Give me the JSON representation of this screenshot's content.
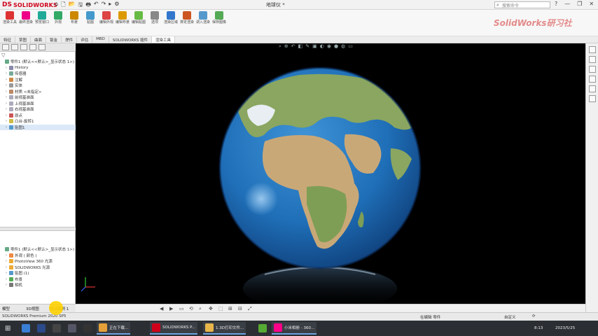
{
  "app": {
    "logo_prefix": "DS",
    "logo_name": "SOLIDWORKS",
    "doc_title": "地球仪 *",
    "search_placeholder": "搜索命令",
    "watermark": "SolidWorks研习社"
  },
  "quick_access": [
    "⌂",
    "🗋",
    "📂",
    "🖫",
    "🖶",
    "↶",
    "↷",
    "▸",
    "⚙"
  ],
  "window_buttons": [
    "?",
    "—",
    "❐",
    "✕"
  ],
  "ribbon_tools": [
    {
      "label": "渲染工具",
      "color": "#d33"
    },
    {
      "label": "最终渲染",
      "color": "#e08"
    },
    {
      "label": "预览窗口",
      "color": "#2a9"
    },
    {
      "label": "外观",
      "color": "#3a6"
    },
    {
      "label": "布景",
      "color": "#c80"
    },
    {
      "label": "贴图",
      "color": "#49c"
    },
    {
      "label": "编辑外观",
      "color": "#d44"
    },
    {
      "label": "编辑布景",
      "color": "#d90"
    },
    {
      "label": "编辑贴图",
      "color": "#6b4"
    },
    {
      "label": "选项",
      "color": "#888"
    },
    {
      "label": "渲染区域",
      "color": "#37c"
    },
    {
      "label": "排定渲染",
      "color": "#c52"
    },
    {
      "label": "调入渲染",
      "color": "#59c"
    },
    {
      "label": "保存图像",
      "color": "#5a5"
    }
  ],
  "tabs": [
    "特征",
    "草图",
    "曲面",
    "钣金",
    "焊件",
    "评估",
    "MBD",
    "SOLIDWORKS 插件",
    "渲染工具"
  ],
  "active_tab": 8,
  "feature_tree": [
    {
      "label": "零件1 (默认<<默认>_显示状态 1>)",
      "color": "#6a8"
    },
    {
      "label": "History",
      "color": "#88a"
    },
    {
      "label": "传感器",
      "color": "#7a9"
    },
    {
      "label": "注解",
      "color": "#c84"
    },
    {
      "label": "实体",
      "color": "#999"
    },
    {
      "label": "材质 <未指定>",
      "color": "#b86"
    },
    {
      "label": "前视基准面",
      "color": "#aab"
    },
    {
      "label": "上视基准面",
      "color": "#aab"
    },
    {
      "label": "右视基准面",
      "color": "#aab"
    },
    {
      "label": "原点",
      "color": "#c55"
    },
    {
      "label": "凸台-旋转1",
      "color": "#cb4"
    },
    {
      "label": "贴图1",
      "color": "#59c"
    }
  ],
  "appearance_tree": [
    {
      "label": "零件1 (默认<<默认>_显示状态 1>)",
      "color": "#6a8"
    },
    {
      "label": "外观 ( 颜色 )",
      "color": "#e84"
    },
    {
      "label": "PhotoView 360 光源",
      "color": "#ea3"
    },
    {
      "label": "SOLIDWORKS 光源",
      "color": "#ea3"
    },
    {
      "label": "贴图 (1)",
      "color": "#59c"
    },
    {
      "label": "布景",
      "color": "#5a5"
    },
    {
      "label": "相机",
      "color": "#777"
    }
  ],
  "status": {
    "product": "SOLIDWORKS Premium 2020 SP5",
    "mode": "在编辑 零件",
    "units": "自定义",
    "rebuild": "⟳"
  },
  "bottom_tabs": [
    "模型",
    "3D视图",
    "运动算例 1"
  ],
  "taskbar": {
    "start": "⊞",
    "apps": [
      {
        "label": "",
        "color": "#3a7fd6",
        "active": false
      },
      {
        "label": "",
        "color": "#2b4a8a",
        "active": false
      },
      {
        "label": "",
        "color": "#444",
        "active": false
      },
      {
        "label": "",
        "color": "#556",
        "active": false
      },
      {
        "label": "",
        "color": "#333",
        "active": false
      },
      {
        "label": "正在下载...",
        "color": "#e5a03a",
        "active": true
      },
      {
        "label": "SOLIDWORKS P...",
        "color": "#d0021b",
        "active": true
      },
      {
        "label": "1.3D打印文件...",
        "color": "#e8b54a",
        "active": true
      },
      {
        "label": "",
        "color": "#5a3",
        "active": false
      },
      {
        "label": "小米相册 - 360...",
        "color": "#f08",
        "active": true
      }
    ],
    "time": "8:13",
    "date": "2023/5/25"
  },
  "colors": {
    "accent": "#d0021b",
    "ocean": "#1f6fb8",
    "land": "#8aa660",
    "desert": "#c9a878"
  }
}
